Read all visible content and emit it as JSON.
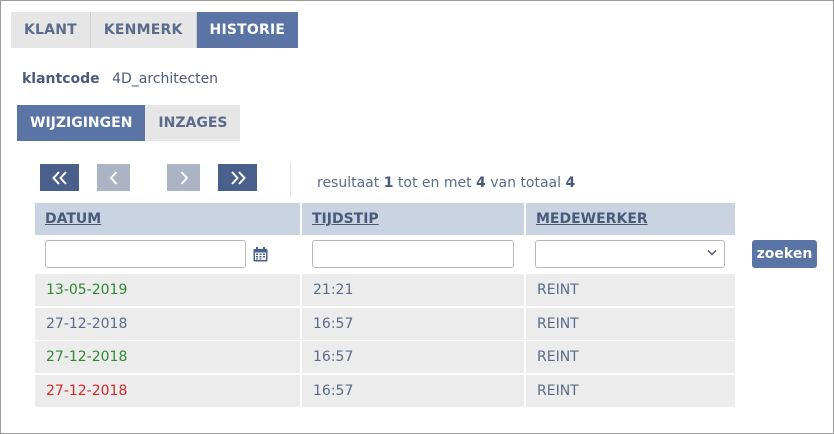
{
  "tabs": [
    {
      "label": "KLANT",
      "active": false
    },
    {
      "label": "KENMERK",
      "active": false
    },
    {
      "label": "HISTORIE",
      "active": true
    }
  ],
  "klant": {
    "label": "klantcode",
    "value": "4D_architecten"
  },
  "subtabs": [
    {
      "label": "WIJZIGINGEN",
      "active": true
    },
    {
      "label": "INZAGES",
      "active": false
    }
  ],
  "pager": {
    "first_icon": "double-chevron-left-icon",
    "prev_icon": "chevron-left-icon",
    "next_icon": "chevron-right-icon",
    "last_icon": "double-chevron-right-icon",
    "text_prefix": "resultaat",
    "from": "1",
    "mid": "tot en met",
    "to": "4",
    "total_label": "van totaal",
    "total": "4"
  },
  "columns": {
    "datum": "DATUM",
    "tijdstip": "TIJDSTIP",
    "medewerker": "MEDEWERKER"
  },
  "filters": {
    "datum": "",
    "tijdstip": "",
    "medewerker": "",
    "calendar_icon": "calendar-icon",
    "search_label": "zoeken"
  },
  "colors": {
    "accent": "#5a74a5",
    "header": "#c9d3e2",
    "green": "#2f8a2f",
    "red": "#d42a2a"
  },
  "rows": [
    {
      "datum": "13-05-2019",
      "tijdstip": "21:21",
      "medewerker": "REINT",
      "color": "green"
    },
    {
      "datum": "27-12-2018",
      "tijdstip": "16:57",
      "medewerker": "REINT",
      "color": "default"
    },
    {
      "datum": "27-12-2018",
      "tijdstip": "16:57",
      "medewerker": "REINT",
      "color": "green"
    },
    {
      "datum": "27-12-2018",
      "tijdstip": "16:57",
      "medewerker": "REINT",
      "color": "red"
    }
  ]
}
